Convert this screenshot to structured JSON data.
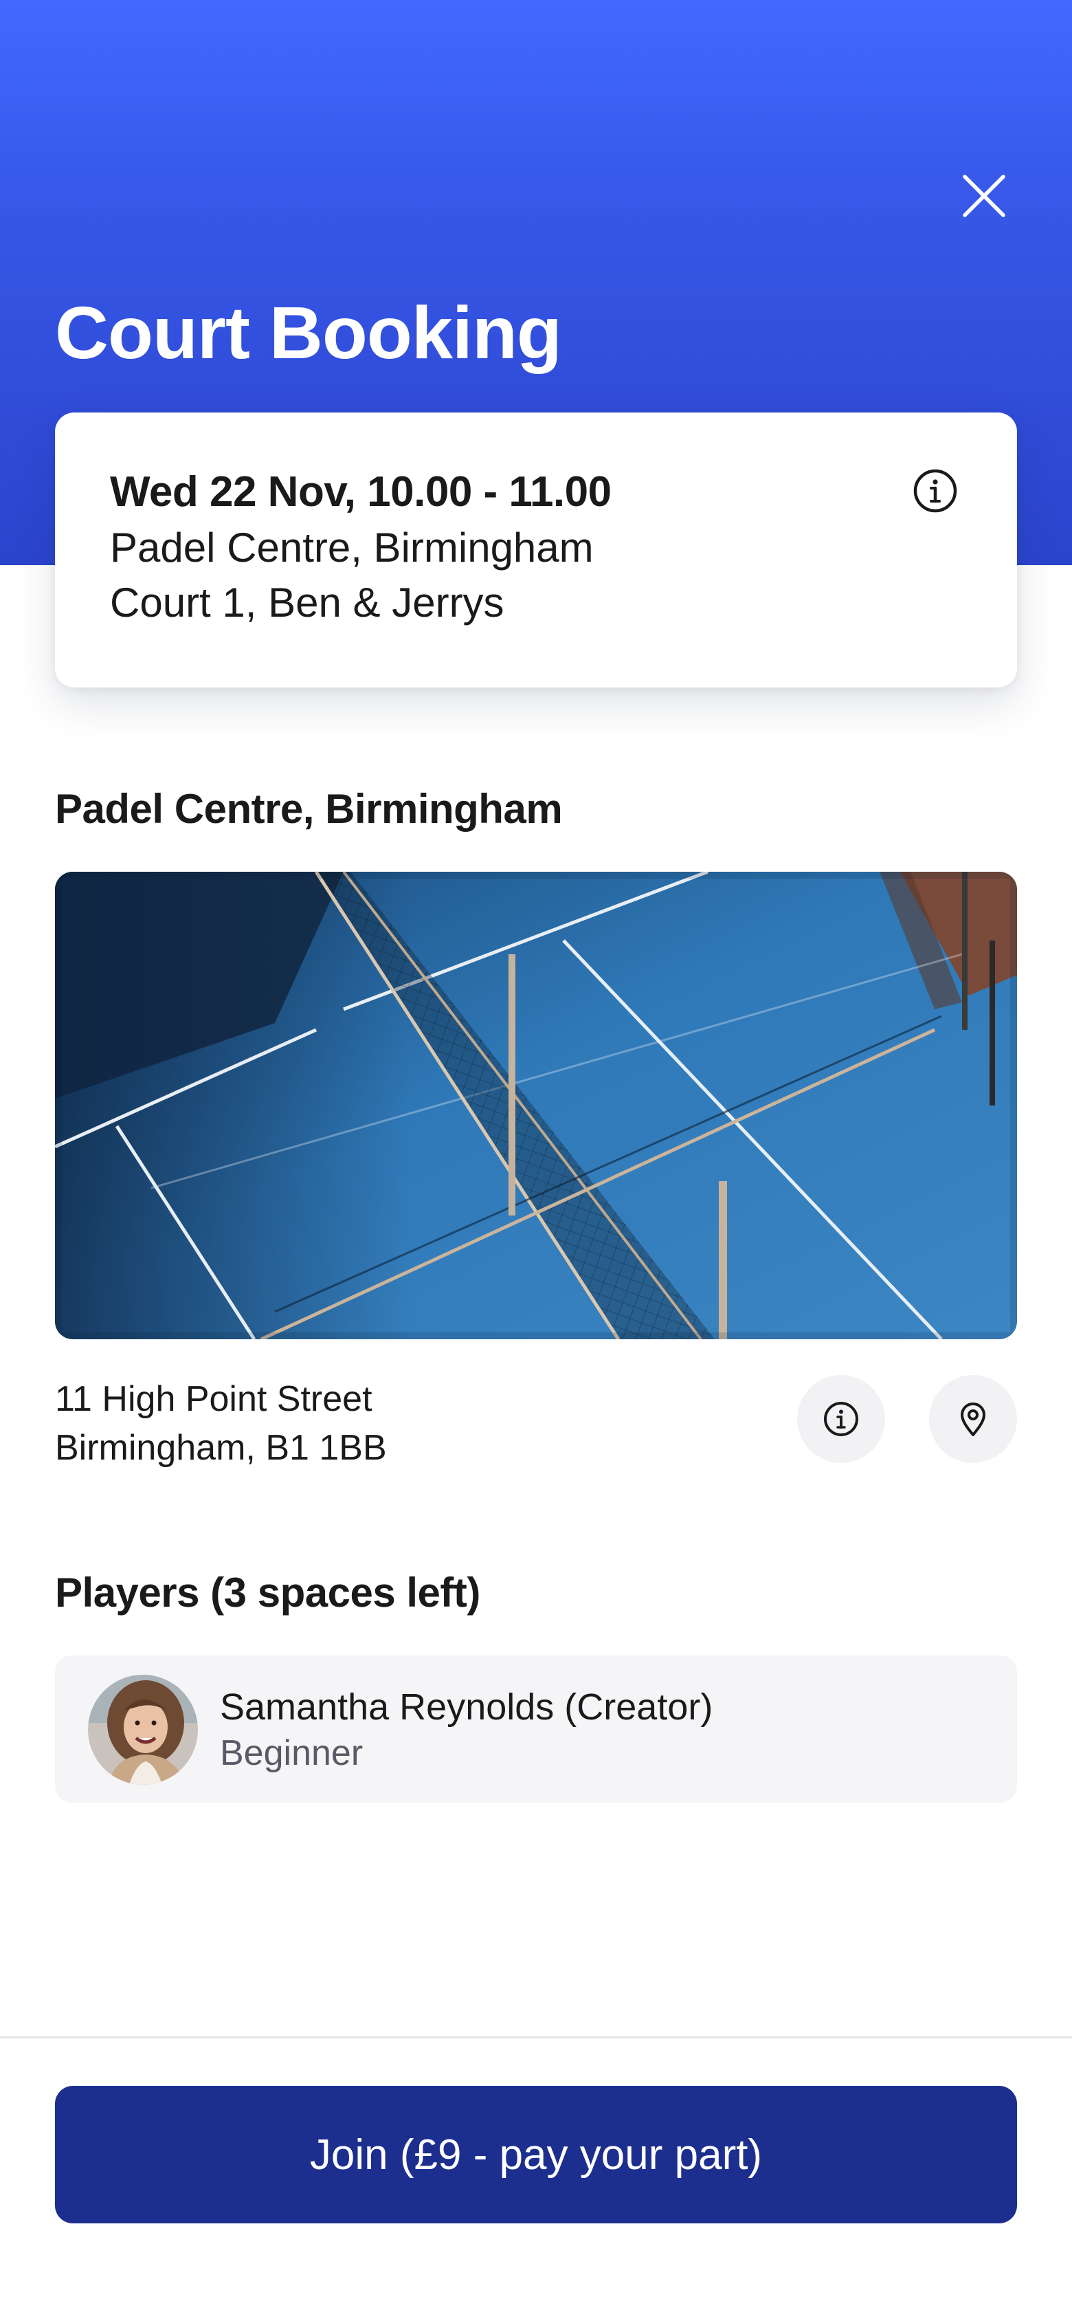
{
  "colors": {
    "hero_top": "#4169ff",
    "hero_bottom": "#2b44cc",
    "primary_button": "#1c2f8f",
    "card_background": "#f5f4f7",
    "icon_button_background": "#f2f1f4"
  },
  "header": {
    "title": "Court Booking",
    "close_icon": "close-icon"
  },
  "booking": {
    "when": "Wed 22 Nov, 10.00 - 11.00",
    "venue": "Padel Centre, Birmingham",
    "court": "Court 1, Ben & Jerrys",
    "info_icon": "info-icon"
  },
  "venue": {
    "title": "Padel Centre, Birmingham",
    "address_line1": "11 High Point Street",
    "address_line2": "Birmingham, B1 1BB",
    "info_icon": "info-icon",
    "location_icon": "map-pin-icon"
  },
  "players": {
    "title": "Players (3 spaces left)",
    "list": [
      {
        "name": "Samantha Reynolds (Creator)",
        "level": "Beginner"
      }
    ]
  },
  "footer": {
    "join_label": "Join (£9 - pay your part)"
  }
}
